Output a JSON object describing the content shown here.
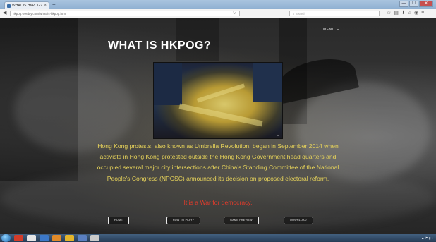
{
  "browser": {
    "tab_title": "WHAT IS HKPOG?",
    "new_tab": "+",
    "window_buttons": [
      "—",
      "☐",
      "✕"
    ],
    "url": "hkpog.weebly.com/what-is-hkpog.html",
    "search_placeholder": "Search",
    "toolbar_icons": [
      "star-icon",
      "bookmarks-icon",
      "download-icon",
      "home-icon",
      "pocket-icon",
      "menu-icon"
    ]
  },
  "page": {
    "title": "WHAT IS HKPOG?",
    "menu_label": "MENU ☰",
    "body_text": "Hong Kong protests, also known as Umbrella Revolution, began in September 2014 when activists in Hong Kong protested outside the Hong Kong Government head quarters and occupied several major city intersections after China's Standing Committee of the National People's Congress (NPCSC) announced its decision on proposed electoral reform.",
    "tagline": "It is a War for democracy.",
    "nav_buttons": [
      "HOME",
      "HOW TO PLAY?",
      "GAME PREVIEW",
      "DOWNLOAD"
    ]
  },
  "colors": {
    "body_text": "#e7d35a",
    "tagline": "#e23b2b",
    "title": "#ffffff"
  }
}
